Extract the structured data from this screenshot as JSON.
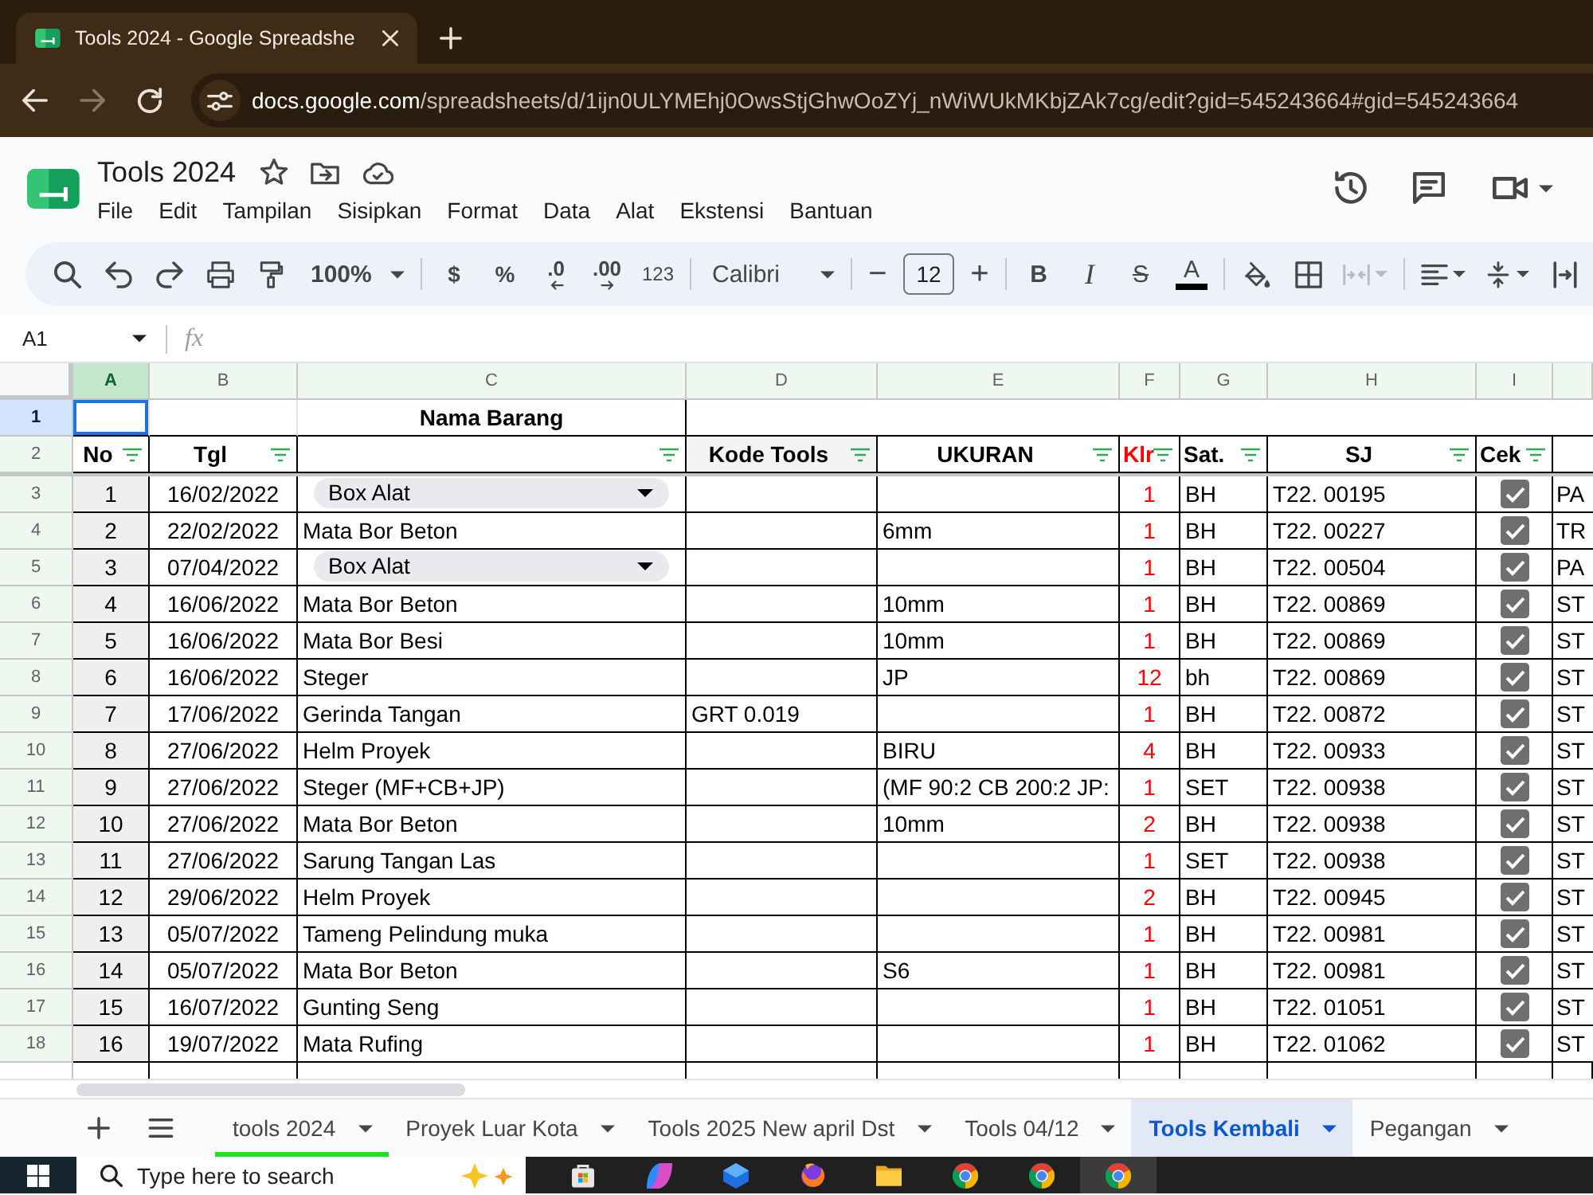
{
  "browser": {
    "tab_title": "Tools 2024 - Google Spreadshe",
    "url": "docs.google.com/spreadsheets/d/1ijn0ULYMEhj0OwsStjGhwOoZYj_nWiWUkMKbjZAk7cg/edit?gid=545243664#gid=545243664",
    "nav": [
      {
        "kind": "back",
        "disabled": false
      },
      {
        "kind": "forward",
        "disabled": true
      },
      {
        "kind": "reload",
        "disabled": false
      }
    ]
  },
  "document": {
    "title": "Tools 2024",
    "menu": [
      "File",
      "Edit",
      "Tampilan",
      "Sisipkan",
      "Format",
      "Data",
      "Alat",
      "Ekstensi",
      "Bantuan"
    ]
  },
  "toolbar": [
    {
      "kind": "search",
      "disabled": false
    },
    {
      "kind": "undo",
      "disabled": false
    },
    {
      "kind": "redo",
      "disabled": false
    },
    {
      "kind": "print",
      "disabled": false
    },
    {
      "kind": "paint_format",
      "disabled": false
    },
    {
      "kind": "zoom",
      "label": "100%",
      "disabled": false
    },
    {
      "kind": "separator"
    },
    {
      "kind": "currency",
      "label": "$",
      "disabled": false
    },
    {
      "kind": "percent",
      "label": "%",
      "disabled": false
    },
    {
      "kind": "decimal_decrease",
      "label": ".0",
      "disabled": false
    },
    {
      "kind": "decimal_increase",
      "label": ".00",
      "disabled": false
    },
    {
      "kind": "number_format",
      "label": "123",
      "disabled": false
    },
    {
      "kind": "separator"
    },
    {
      "kind": "font",
      "label": "Calibri",
      "disabled": false
    },
    {
      "kind": "separator"
    },
    {
      "kind": "size_down",
      "label": "−",
      "disabled": false
    },
    {
      "kind": "font_size",
      "value": "12",
      "disabled": false
    },
    {
      "kind": "size_up",
      "label": "+",
      "disabled": false
    },
    {
      "kind": "separator"
    },
    {
      "kind": "bold",
      "label": "B",
      "disabled": false
    },
    {
      "kind": "italic",
      "label": "I",
      "disabled": false
    },
    {
      "kind": "strikethrough",
      "label": "S",
      "disabled": false
    },
    {
      "kind": "text_color",
      "label": "A",
      "disabled": false
    },
    {
      "kind": "separator"
    },
    {
      "kind": "fill_color",
      "disabled": false
    },
    {
      "kind": "borders",
      "disabled": false
    },
    {
      "kind": "merge",
      "disabled": true
    },
    {
      "kind": "separator"
    },
    {
      "kind": "align",
      "disabled": false
    },
    {
      "kind": "vertical_align",
      "disabled": false
    },
    {
      "kind": "wrap",
      "disabled": false
    }
  ],
  "formula_bar": {
    "cell_ref": "A1",
    "function_label": "fx"
  },
  "sheet": {
    "columns": [
      {
        "label": "A",
        "selected": true
      },
      {
        "label": "B",
        "selected": false
      },
      {
        "label": "C",
        "selected": false
      },
      {
        "label": "D",
        "selected": false
      },
      {
        "label": "E",
        "selected": false
      },
      {
        "label": "F",
        "selected": false
      },
      {
        "label": "G",
        "selected": false
      },
      {
        "label": "H",
        "selected": false
      },
      {
        "label": "I",
        "selected": false
      }
    ],
    "title_row": {
      "row_number": "1",
      "selected": true,
      "title": "Nama Barang"
    },
    "header_row": {
      "row_number": "2",
      "selected": false,
      "cells": [
        {
          "label": "No",
          "filter": true
        },
        {
          "label": "Tgl",
          "filter": true
        },
        {
          "filter": true
        },
        {
          "label": "Kode Tools",
          "filter": true
        },
        {
          "label": "UKURAN",
          "filter": true
        },
        {
          "label": "Klr",
          "filter": true
        },
        {
          "label": "Sat.",
          "filter": true
        },
        {
          "label": "SJ",
          "filter": true
        },
        {
          "label": "Cek",
          "filter": true
        }
      ]
    },
    "rows": [
      {
        "row_number": "3",
        "selected": false,
        "no": "1",
        "tgl": "16/02/2022",
        "item": {
          "kind": "dropdown",
          "text": "Box Alat"
        },
        "klr": "1",
        "sat": "BH",
        "sj": "T22. 00195",
        "checked": true,
        "column_j": "PA"
      },
      {
        "row_number": "4",
        "selected": false,
        "no": "2",
        "tgl": "22/02/2022",
        "item": {
          "kind": "text",
          "text": "Mata Bor Beton"
        },
        "ukuran": "6mm",
        "klr": "1",
        "sat": "BH",
        "sj": "T22. 00227",
        "checked": true,
        "column_j": "TR"
      },
      {
        "row_number": "5",
        "selected": false,
        "no": "3",
        "tgl": "07/04/2022",
        "item": {
          "kind": "dropdown",
          "text": "Box Alat"
        },
        "klr": "1",
        "sat": "BH",
        "sj": "T22. 00504",
        "checked": true,
        "column_j": "PA"
      },
      {
        "row_number": "6",
        "selected": false,
        "no": "4",
        "tgl": "16/06/2022",
        "item": {
          "kind": "text",
          "text": "Mata Bor Beton"
        },
        "ukuran": "10mm",
        "klr": "1",
        "sat": "BH",
        "sj": "T22. 00869",
        "checked": true,
        "column_j": "ST"
      },
      {
        "row_number": "7",
        "selected": false,
        "no": "5",
        "tgl": "16/06/2022",
        "item": {
          "kind": "text",
          "text": "Mata Bor Besi"
        },
        "ukuran": "10mm",
        "klr": "1",
        "sat": "BH",
        "sj": "T22. 00869",
        "checked": true,
        "column_j": "ST"
      },
      {
        "row_number": "8",
        "selected": false,
        "no": "6",
        "tgl": "16/06/2022",
        "item": {
          "kind": "text",
          "text": "Steger"
        },
        "ukuran": "JP",
        "klr": "12",
        "sat": "bh",
        "sj": "T22. 00869",
        "checked": true,
        "column_j": "ST"
      },
      {
        "row_number": "9",
        "selected": false,
        "no": "7",
        "tgl": "17/06/2022",
        "item": {
          "kind": "text",
          "text": "Gerinda Tangan"
        },
        "kode_tools": "GRT 0.019",
        "klr": "1",
        "sat": "BH",
        "sj": "T22. 00872",
        "checked": true,
        "column_j": "ST"
      },
      {
        "row_number": "10",
        "selected": false,
        "no": "8",
        "tgl": "27/06/2022",
        "item": {
          "kind": "text",
          "text": "Helm Proyek"
        },
        "ukuran": "BIRU",
        "klr": "4",
        "sat": "BH",
        "sj": "T22. 00933",
        "checked": true,
        "column_j": "ST"
      },
      {
        "row_number": "11",
        "selected": false,
        "no": "9",
        "tgl": "27/06/2022",
        "item": {
          "kind": "text",
          "text": "Steger (MF+CB+JP)"
        },
        "ukuran": "(MF 90:2 CB 200:2 JP:",
        "klr": "1",
        "sat": "SET",
        "sj": "T22. 00938",
        "checked": true,
        "column_j": "ST"
      },
      {
        "row_number": "12",
        "selected": false,
        "no": "10",
        "tgl": "27/06/2022",
        "item": {
          "kind": "text",
          "text": "Mata Bor Beton"
        },
        "ukuran": "10mm",
        "klr": "2",
        "sat": "BH",
        "sj": "T22. 00938",
        "checked": true,
        "column_j": "ST"
      },
      {
        "row_number": "13",
        "selected": false,
        "no": "11",
        "tgl": "27/06/2022",
        "item": {
          "kind": "text",
          "text": "Sarung Tangan Las"
        },
        "klr": "1",
        "sat": "SET",
        "sj": "T22. 00938",
        "checked": true,
        "column_j": "ST"
      },
      {
        "row_number": "14",
        "selected": false,
        "no": "12",
        "tgl": "29/06/2022",
        "item": {
          "kind": "text",
          "text": "Helm Proyek"
        },
        "klr": "2",
        "sat": "BH",
        "sj": "T22. 00945",
        "checked": true,
        "column_j": "ST"
      },
      {
        "row_number": "15",
        "selected": false,
        "no": "13",
        "tgl": "05/07/2022",
        "item": {
          "kind": "text",
          "text": "Tameng Pelindung muka"
        },
        "klr": "1",
        "sat": "BH",
        "sj": "T22. 00981",
        "checked": true,
        "column_j": "ST"
      },
      {
        "row_number": "16",
        "selected": false,
        "no": "14",
        "tgl": "05/07/2022",
        "item": {
          "kind": "text",
          "text": "Mata Bor Beton"
        },
        "ukuran": "S6",
        "klr": "1",
        "sat": "BH",
        "sj": "T22. 00981",
        "checked": true,
        "column_j": "ST"
      },
      {
        "row_number": "17",
        "selected": false,
        "no": "15",
        "tgl": "16/07/2022",
        "item": {
          "kind": "text",
          "text": "Gunting Seng"
        },
        "klr": "1",
        "sat": "BH",
        "sj": "T22. 01051",
        "checked": true,
        "column_j": "ST"
      },
      {
        "row_number": "18",
        "selected": false,
        "no": "16",
        "tgl": "19/07/2022",
        "item": {
          "kind": "text",
          "text": "Mata Rufing"
        },
        "klr": "1",
        "sat": "BH",
        "sj": "T22. 01062",
        "checked": true,
        "column_j": "ST"
      }
    ]
  },
  "sheet_tabs": [
    {
      "label": "tools 2024",
      "selected": false,
      "color": "#22e022"
    },
    {
      "label": "Proyek Luar Kota",
      "selected": false
    },
    {
      "label": "Tools 2025 New april Dst",
      "selected": false
    },
    {
      "label": "Tools 04/12",
      "selected": false
    },
    {
      "label": "Tools Kembali",
      "selected": true
    },
    {
      "label": "Pegangan",
      "selected": false
    }
  ],
  "taskbar": {
    "search_placeholder": "Type here to search",
    "apps": [
      {
        "kind": "store",
        "selected": false
      },
      {
        "kind": "copilot",
        "selected": false
      },
      {
        "kind": "cube",
        "selected": false
      },
      {
        "kind": "firefox",
        "selected": false
      },
      {
        "kind": "explorer",
        "selected": false
      },
      {
        "kind": "chrome",
        "selected": false
      },
      {
        "kind": "chrome",
        "selected": false
      },
      {
        "kind": "chrome",
        "selected": true
      }
    ]
  }
}
